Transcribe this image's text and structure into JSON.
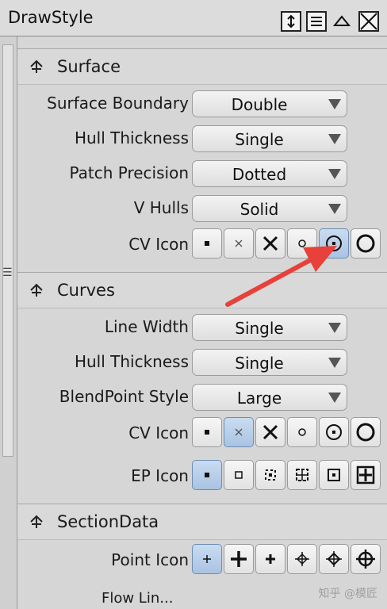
{
  "window": {
    "title": "DrawStyle"
  },
  "sections": [
    {
      "label": "Surface",
      "rows": [
        {
          "label": "Surface Boundary",
          "value": "Double"
        },
        {
          "label": "Hull Thickness",
          "value": "Single"
        },
        {
          "label": "Patch Precision",
          "value": "Dotted"
        },
        {
          "label": "V Hulls",
          "value": "Solid"
        }
      ],
      "icon_row": {
        "label": "CV Icon",
        "selected_index": 4
      }
    },
    {
      "label": "Curves",
      "rows": [
        {
          "label": "Line Width",
          "value": "Single"
        },
        {
          "label": "Hull Thickness",
          "value": "Single"
        },
        {
          "label": "BlendPoint Style",
          "value": "Large"
        }
      ],
      "cv_icon_row": {
        "label": "CV Icon",
        "selected_index": 1
      },
      "ep_icon_row": {
        "label": "EP Icon",
        "selected_index": 0
      }
    },
    {
      "label": "SectionData",
      "point_icon_row": {
        "label": "Point Icon",
        "selected_index": 0
      },
      "partial_label": "Flow Lin..."
    }
  ],
  "annotation": {
    "arrow_color": "#e8403a"
  },
  "watermark": "知乎 @模匠"
}
